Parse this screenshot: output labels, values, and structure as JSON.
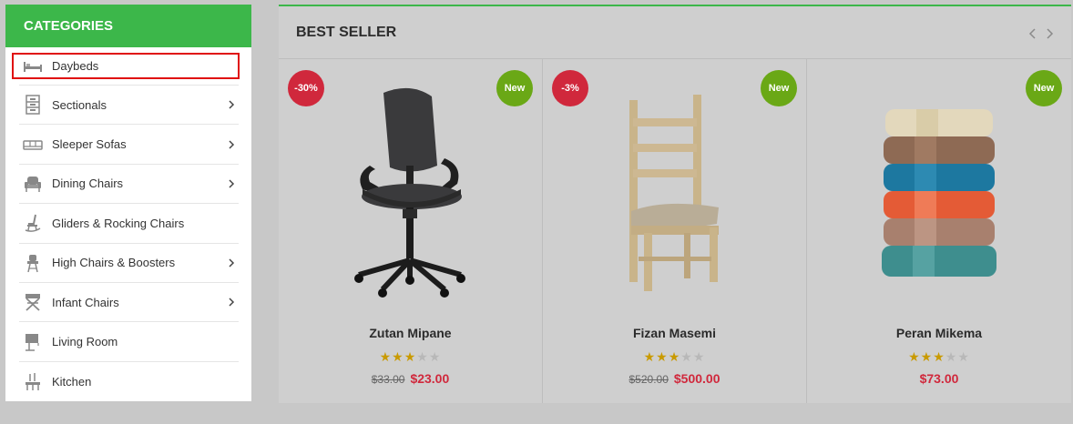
{
  "categories": {
    "title": "CATEGORIES",
    "items": [
      {
        "label": "Daybeds",
        "icon": "daybed-icon",
        "has_submenu": false,
        "selected": true
      },
      {
        "label": "Sectionals",
        "icon": "sectional-icon",
        "has_submenu": true
      },
      {
        "label": "Sleeper Sofas",
        "icon": "sofa-icon",
        "has_submenu": true
      },
      {
        "label": "Dining Chairs",
        "icon": "armchair-icon",
        "has_submenu": true
      },
      {
        "label": "Gliders & Rocking Chairs",
        "icon": "rocking-chair-icon",
        "has_submenu": false
      },
      {
        "label": "High Chairs & Boosters",
        "icon": "high-chair-icon",
        "has_submenu": true
      },
      {
        "label": "Infant Chairs",
        "icon": "infant-chair-icon",
        "has_submenu": true
      },
      {
        "label": "Living Room",
        "icon": "lamp-icon",
        "has_submenu": false
      },
      {
        "label": "Kitchen",
        "icon": "kitchen-icon",
        "has_submenu": false
      }
    ]
  },
  "bestseller": {
    "title": "BEST SELLER",
    "products": [
      {
        "name": "Zutan Mipane",
        "sale_badge": "-30%",
        "new_badge": "New",
        "rating": 3,
        "old_price": "$33.00",
        "price": "$23.00",
        "image": "office-chair"
      },
      {
        "name": "Fizan Masemi",
        "sale_badge": "-3%",
        "new_badge": "New",
        "rating": 3,
        "old_price": "$520.00",
        "price": "$500.00",
        "image": "wooden-chair"
      },
      {
        "name": "Peran Mikema",
        "sale_badge": "",
        "new_badge": "New",
        "rating": 3,
        "old_price": "",
        "price": "$73.00",
        "image": "towel-stack"
      }
    ]
  },
  "colors": {
    "accent": "#3cb74a",
    "sale": "#d0283c",
    "new": "#6aa816",
    "star": "#c99a00"
  }
}
